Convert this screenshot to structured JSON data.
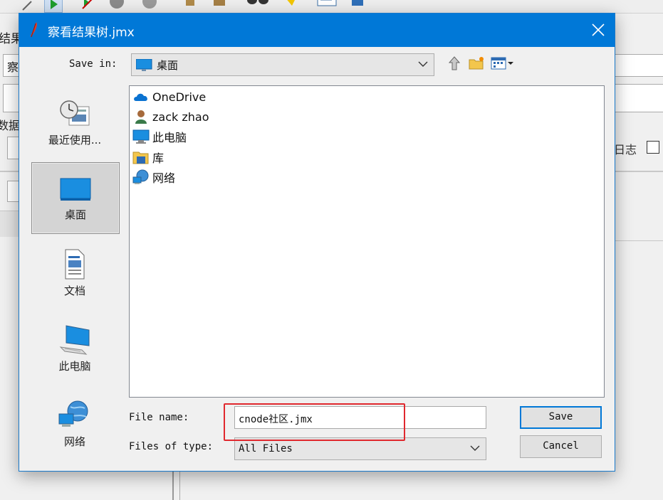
{
  "background_app": {
    "partial_labels": [
      "结果",
      "察",
      "数据",
      "日志"
    ]
  },
  "dialog": {
    "title": "察看结果树.jmx",
    "save_in_label": "Save in:",
    "save_in_value": "桌面",
    "file_name_label": "File name:",
    "file_name_value": "cnode社区.jmx",
    "files_of_type_label": "Files of type:",
    "files_of_type_value": "All Files",
    "save_button": "Save",
    "cancel_button": "Cancel"
  },
  "places": [
    {
      "label": "最近使用...",
      "icon": "recent-icon",
      "selected": false
    },
    {
      "label": "桌面",
      "icon": "desktop-icon",
      "selected": true
    },
    {
      "label": "文档",
      "icon": "documents-icon",
      "selected": false
    },
    {
      "label": "此电脑",
      "icon": "this-pc-icon",
      "selected": false
    },
    {
      "label": "网络",
      "icon": "network-icon",
      "selected": false
    }
  ],
  "files": [
    {
      "name": "OneDrive",
      "icon": "cloud-icon"
    },
    {
      "name": "zack zhao",
      "icon": "user-icon"
    },
    {
      "name": "此电脑",
      "icon": "computer-icon"
    },
    {
      "name": "库",
      "icon": "library-icon"
    },
    {
      "name": "网络",
      "icon": "network-icon"
    }
  ],
  "colors": {
    "titlebar": "#0078d7",
    "highlight": "#e0282e"
  }
}
